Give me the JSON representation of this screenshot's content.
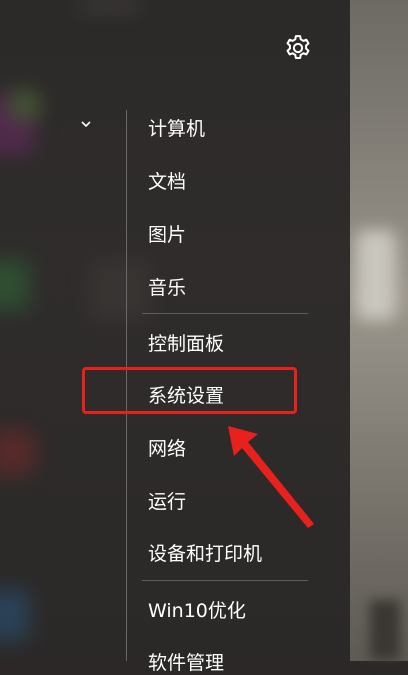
{
  "menu": {
    "items": [
      {
        "label": "计算机"
      },
      {
        "label": "文档"
      },
      {
        "label": "图片"
      },
      {
        "label": "音乐"
      },
      {
        "label": "控制面板"
      },
      {
        "label": "系统设置"
      },
      {
        "label": "网络"
      },
      {
        "label": "运行"
      },
      {
        "label": "设备和打印机"
      },
      {
        "label": "Win10优化"
      },
      {
        "label": "软件管理"
      }
    ]
  },
  "icons": {
    "settings": "gear-icon",
    "expand": "chevron-down-icon"
  },
  "colors": {
    "panel_background": "#2c2a29",
    "text": "#ffffff",
    "annotation": "#e8211c",
    "divider": "#5f5c5a"
  }
}
